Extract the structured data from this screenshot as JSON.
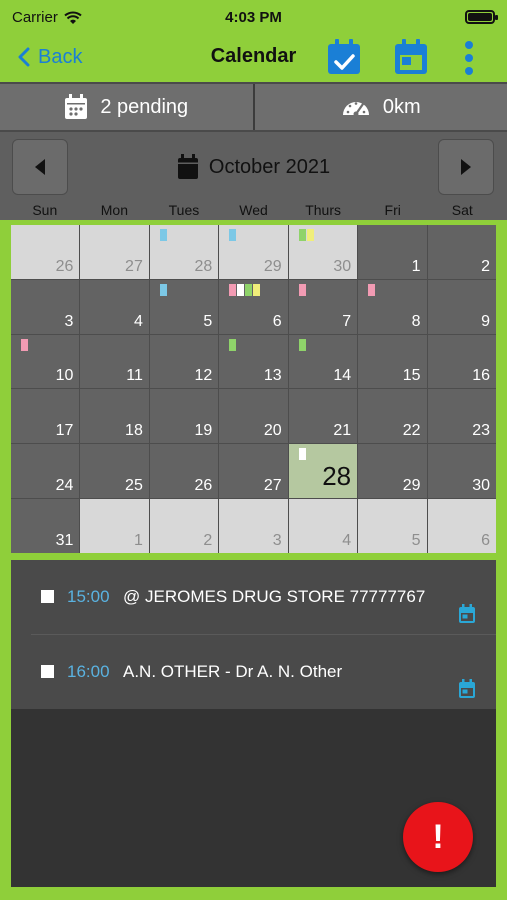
{
  "status_bar": {
    "carrier": "Carrier",
    "time": "4:03 PM"
  },
  "nav": {
    "back_label": "Back",
    "title": "Calendar"
  },
  "summary": {
    "pending": "2 pending",
    "distance": "0km"
  },
  "month": {
    "title": "October 2021"
  },
  "weekdays": [
    "Sun",
    "Mon",
    "Tues",
    "Wed",
    "Thurs",
    "Fri",
    "Sat"
  ],
  "colors": {
    "accent": "#8fcf3a",
    "marker_blue": "#7cc8e6",
    "marker_pink": "#f29bb3",
    "marker_green": "#8fd36a",
    "marker_yellow": "#f0ee7a",
    "marker_white": "#ffffff",
    "today_bg": "#b5c8a0",
    "fab": "#e8141a"
  },
  "days": [
    {
      "n": "26",
      "other": true,
      "m": []
    },
    {
      "n": "27",
      "other": true,
      "m": []
    },
    {
      "n": "28",
      "other": true,
      "m": [
        "blue"
      ]
    },
    {
      "n": "29",
      "other": true,
      "m": [
        "blue"
      ]
    },
    {
      "n": "30",
      "other": true,
      "m": [
        "green",
        "yellow"
      ]
    },
    {
      "n": "1",
      "m": []
    },
    {
      "n": "2",
      "m": []
    },
    {
      "n": "3",
      "m": []
    },
    {
      "n": "4",
      "m": []
    },
    {
      "n": "5",
      "m": [
        "blue"
      ]
    },
    {
      "n": "6",
      "m": [
        "pink",
        "white",
        "green",
        "yellow"
      ]
    },
    {
      "n": "7",
      "m": [
        "pink"
      ]
    },
    {
      "n": "8",
      "m": [
        "pink"
      ]
    },
    {
      "n": "9",
      "m": []
    },
    {
      "n": "10",
      "m": [
        "pink"
      ]
    },
    {
      "n": "11",
      "m": []
    },
    {
      "n": "12",
      "m": []
    },
    {
      "n": "13",
      "m": [
        "green"
      ]
    },
    {
      "n": "14",
      "m": [
        "green"
      ]
    },
    {
      "n": "15",
      "m": []
    },
    {
      "n": "16",
      "m": []
    },
    {
      "n": "17",
      "m": []
    },
    {
      "n": "18",
      "m": []
    },
    {
      "n": "19",
      "m": []
    },
    {
      "n": "20",
      "m": []
    },
    {
      "n": "21",
      "m": []
    },
    {
      "n": "22",
      "m": []
    },
    {
      "n": "23",
      "m": []
    },
    {
      "n": "24",
      "m": []
    },
    {
      "n": "25",
      "m": []
    },
    {
      "n": "26",
      "m": []
    },
    {
      "n": "27",
      "m": []
    },
    {
      "n": "28",
      "today": true,
      "m": [
        "white"
      ]
    },
    {
      "n": "29",
      "m": []
    },
    {
      "n": "30",
      "m": []
    },
    {
      "n": "31",
      "m": []
    },
    {
      "n": "1",
      "other": true,
      "m": []
    },
    {
      "n": "2",
      "other": true,
      "m": []
    },
    {
      "n": "3",
      "other": true,
      "m": []
    },
    {
      "n": "4",
      "other": true,
      "m": []
    },
    {
      "n": "5",
      "other": true,
      "m": []
    },
    {
      "n": "6",
      "other": true,
      "m": []
    }
  ],
  "events": [
    {
      "time": "15:00",
      "title": "@ JEROMES DRUG STORE 77777767",
      "icon": "calendar-icon"
    },
    {
      "time": "16:00",
      "title": "A.N. OTHER - Dr A. N. Other",
      "icon": "calendar-icon"
    }
  ],
  "fab": {
    "label": "!"
  }
}
